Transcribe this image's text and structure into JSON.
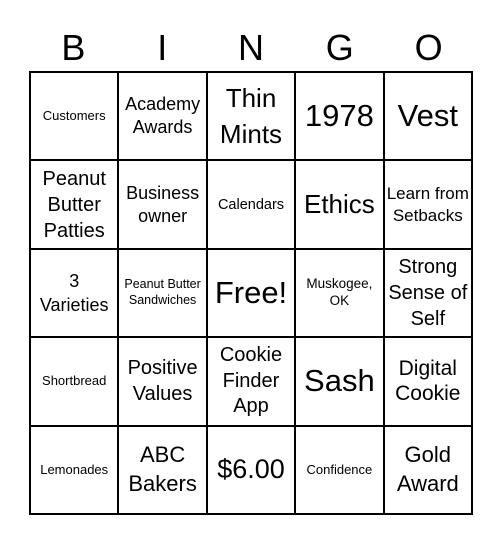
{
  "header": {
    "letters": [
      "B",
      "I",
      "N",
      "G",
      "O"
    ]
  },
  "card": {
    "cells": [
      [
        "Customers",
        "Academy Awards",
        "Thin Mints",
        "1978",
        "Vest"
      ],
      [
        "Peanut Butter Patties",
        "Business owner",
        "Calendars",
        "Ethics",
        "Learn from Setbacks"
      ],
      [
        "3 Varieties",
        "Peanut Butter Sandwiches",
        "Free!",
        "Muskogee, OK",
        "Strong Sense of Self"
      ],
      [
        "Shortbread",
        "Positive Values",
        "Cookie Finder App",
        "Sash",
        "Digital Cookie"
      ],
      [
        "Lemonades",
        "ABC Bakers",
        "$6.00",
        "Confidence",
        "Gold Award"
      ]
    ],
    "free_space": "Free!"
  }
}
